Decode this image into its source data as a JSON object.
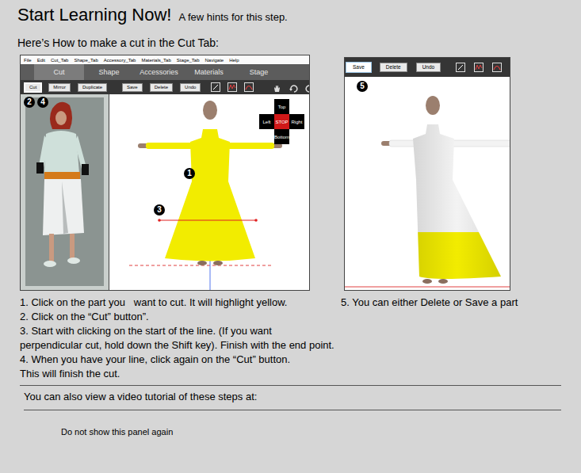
{
  "title": "Start Learning Now!",
  "subtitle": "A few hints for this step.",
  "heading": "Here’s How to make a cut in the Cut Tab:",
  "screenshot_main": {
    "menu": [
      "File",
      "Edit",
      "Cut_Tab",
      "Shape_Tab",
      "Accessory_Tab",
      "Materials_Tab",
      "Stage_Tab",
      "Navigate",
      "Help"
    ],
    "tabs": [
      {
        "label": "Cut",
        "selected": true
      },
      {
        "label": "Shape",
        "selected": false
      },
      {
        "label": "Accessories",
        "selected": false
      },
      {
        "label": "Materials",
        "selected": false
      },
      {
        "label": "Stage",
        "selected": false
      }
    ],
    "toolbar": [
      {
        "label": "Cut",
        "selected": true
      },
      {
        "label": "Mirror",
        "selected": false
      },
      {
        "label": "Duplicate",
        "selected": false
      },
      {
        "label": "Save",
        "selected": false
      },
      {
        "label": "Delete",
        "selected": false
      },
      {
        "label": "Undo",
        "selected": false
      }
    ],
    "preview_badges": [
      "2",
      "4"
    ],
    "viewport_badges": [
      "1",
      "3"
    ],
    "nav_cube": {
      "top": "Top",
      "left": "Left",
      "center": "STOP",
      "right": "Right",
      "bottom": "Bottom"
    },
    "dress_selected": true
  },
  "screenshot_result": {
    "toolbar": [
      {
        "label": "Save",
        "selected": true
      },
      {
        "label": "Delete",
        "selected": false
      },
      {
        "label": "Undo",
        "selected": false
      }
    ],
    "badge": "5",
    "top_selected": false,
    "hem_selected": true
  },
  "steps": [
    {
      "lines": [
        "1. Click on the part you   want to cut. It will highlight yellow."
      ]
    },
    {
      "lines": [
        "2. Click on the “Cut” button”."
      ]
    },
    {
      "lines": [
        "3. Start with clicking on the start of the line. (If you want",
        "perpendicular cut, hold down the Shift key). Finish with the end point."
      ]
    },
    {
      "lines": [
        "4. When you have your line, click again on the “Cut” button.",
        "This will finish the cut."
      ]
    }
  ],
  "note": "5. You can either Delete or Save a part",
  "video_text": "You can also view a video tutorial of these steps at:",
  "dont_show": "Do not show this panel again"
}
